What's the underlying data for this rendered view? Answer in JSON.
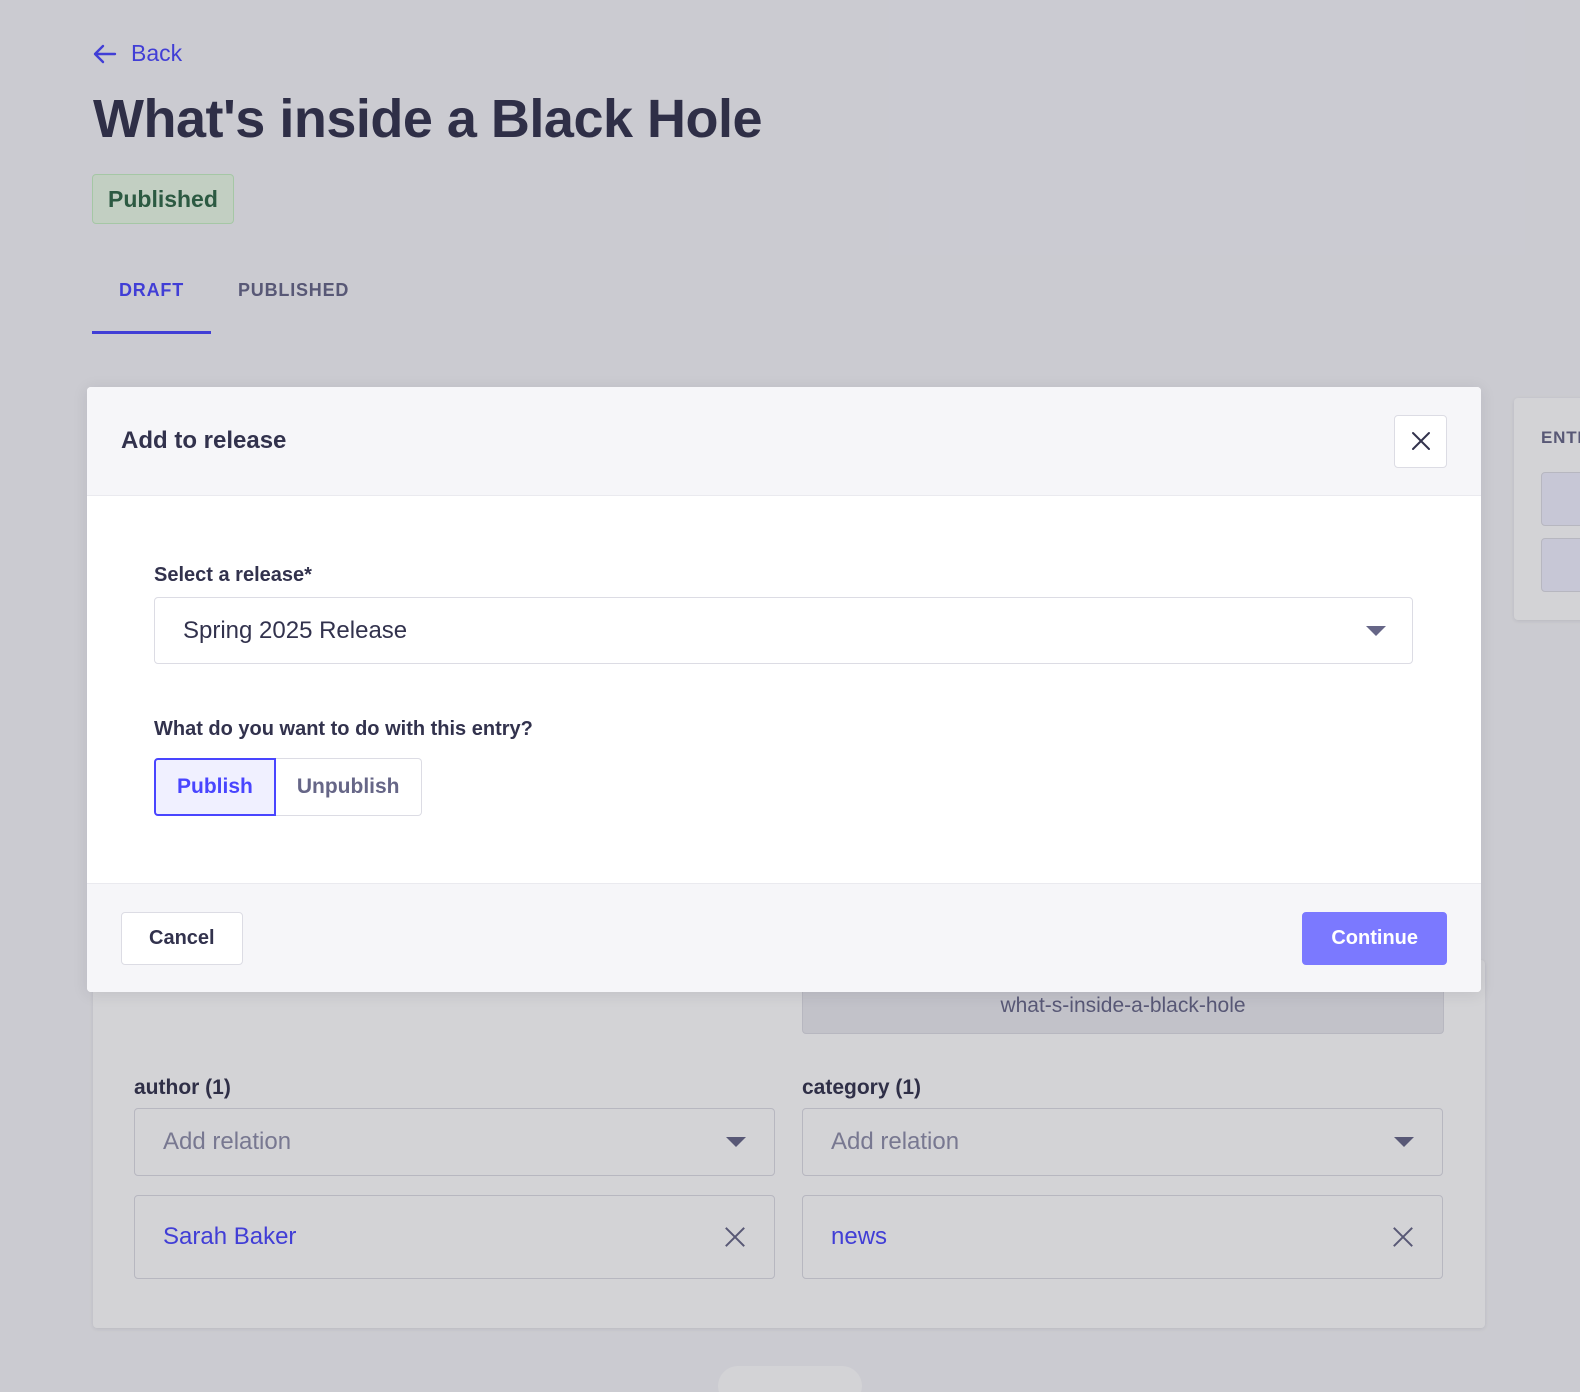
{
  "header": {
    "back_label": "Back",
    "title": "What's inside a Black Hole",
    "status": "Published"
  },
  "tabs": [
    {
      "label": "DRAFT",
      "active": true
    },
    {
      "label": "PUBLISHED",
      "active": false
    }
  ],
  "side_panel": {
    "label": "ENTRY"
  },
  "form": {
    "slug_value": "what-s-inside-a-black-hole",
    "author": {
      "label": "author (1)",
      "placeholder": "Add relation",
      "items": [
        "Sarah Baker"
      ]
    },
    "category": {
      "label": "category (1)",
      "placeholder": "Add relation",
      "items": [
        "news"
      ]
    }
  },
  "modal": {
    "title": "Add to release",
    "select_label": "Select a release*",
    "select_value": "Spring 2025 Release",
    "action_label": "What do you want to do with this entry?",
    "actions": [
      {
        "label": "Publish",
        "selected": true
      },
      {
        "label": "Unpublish",
        "selected": false
      }
    ],
    "cancel_label": "Cancel",
    "continue_label": "Continue"
  },
  "colors": {
    "primary": "#4945ff",
    "primary_light": "#7b79ff",
    "success_bg": "#eafbe7",
    "success_text": "#2f6846",
    "text_dark": "#32324d",
    "text_muted": "#666687"
  }
}
